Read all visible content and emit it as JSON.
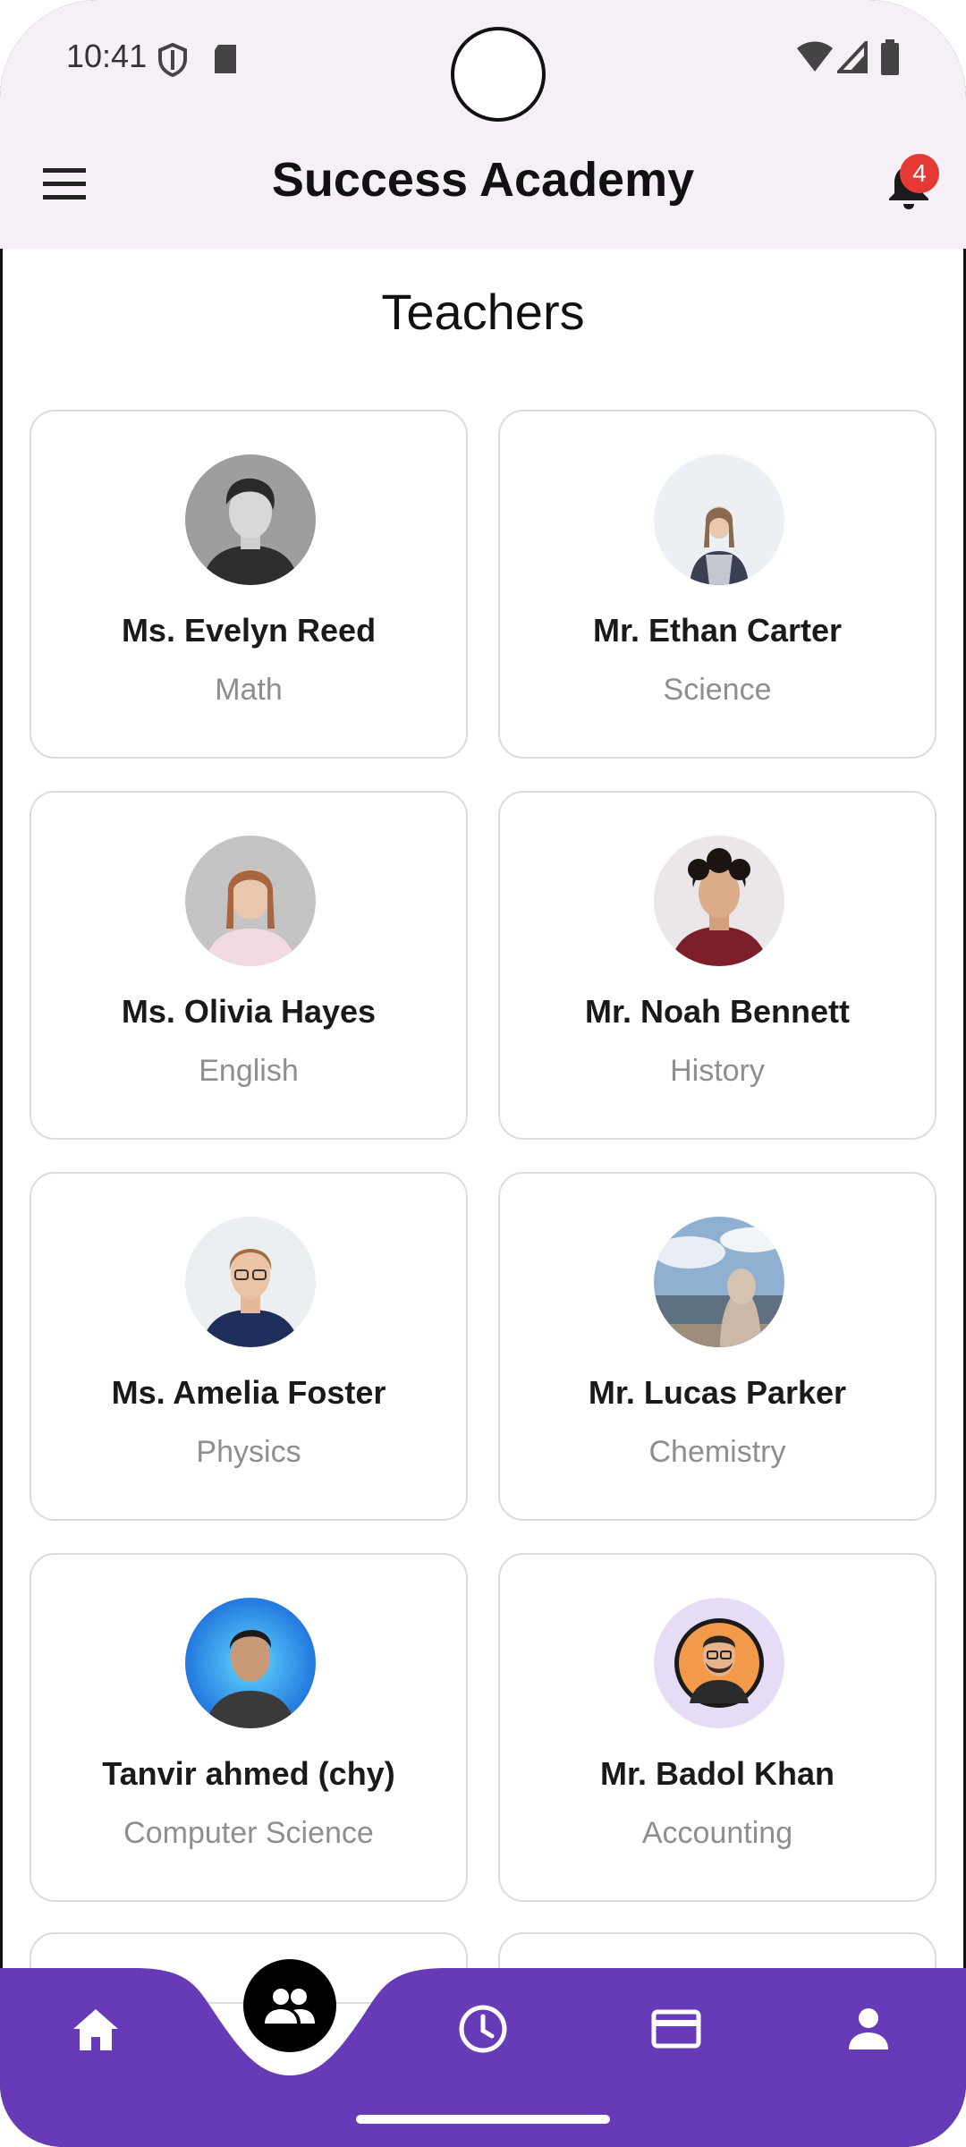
{
  "status_bar": {
    "time": "10:41"
  },
  "app_bar": {
    "title": "Success Academy",
    "notification_count": "4"
  },
  "page": {
    "title": "Teachers"
  },
  "teachers": [
    {
      "name": "Ms. Evelyn Reed",
      "subject": "Math"
    },
    {
      "name": "Mr. Ethan Carter",
      "subject": "Science"
    },
    {
      "name": "Ms. Olivia Hayes",
      "subject": "English"
    },
    {
      "name": "Mr. Noah Bennett",
      "subject": "History"
    },
    {
      "name": "Ms. Amelia Foster",
      "subject": "Physics"
    },
    {
      "name": "Mr. Lucas Parker",
      "subject": "Chemistry"
    },
    {
      "name": "Tanvir ahmed (chy)",
      "subject": "Computer Science"
    },
    {
      "name": "Mr. Badol Khan",
      "subject": "Accounting"
    }
  ],
  "bottom_nav": {
    "items": [
      "home-icon",
      "people-icon",
      "clock-icon",
      "card-icon",
      "person-icon"
    ],
    "selected": "people-icon"
  },
  "colors": {
    "accent": "#673ab7",
    "topbar": "#f4f0f6",
    "badge": "#e53935"
  }
}
